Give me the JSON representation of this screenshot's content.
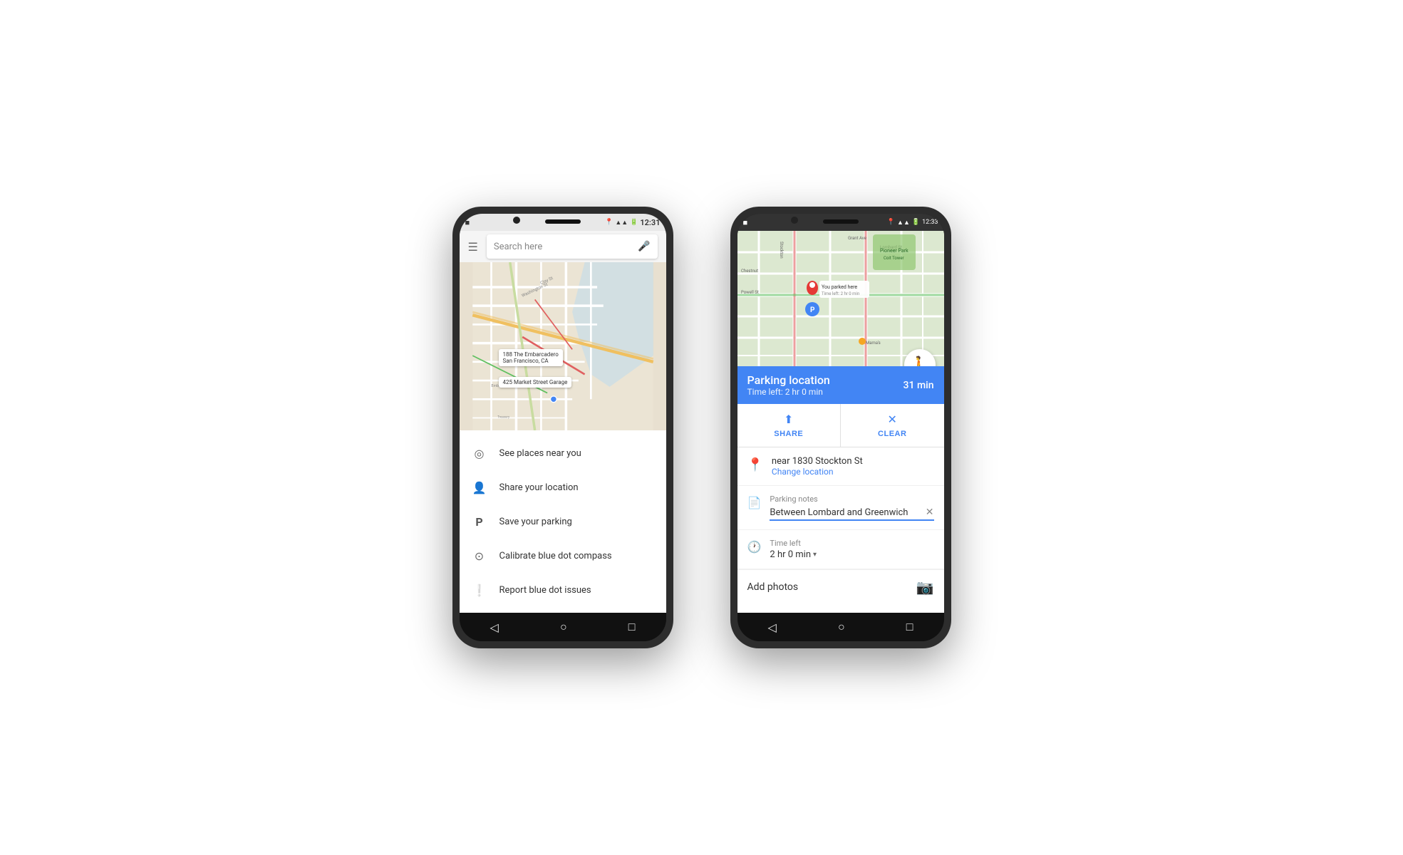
{
  "phone1": {
    "status_bar": {
      "left_icon": "☰",
      "time": "12:31",
      "icons": "▲ ⬆ ■ 🔋"
    },
    "search": {
      "placeholder": "Search here",
      "mic_icon": "🎤",
      "menu_icon": "☰"
    },
    "menu_items": [
      {
        "icon": "◎",
        "label": "See places near you"
      },
      {
        "icon": "👤",
        "label": "Share your location"
      },
      {
        "icon": "P",
        "label": "Save your parking"
      },
      {
        "icon": "⊙",
        "label": "Calibrate blue dot compass"
      },
      {
        "icon": "!",
        "label": "Report blue dot issues"
      }
    ],
    "nav": {
      "back": "◁",
      "home": "○",
      "square": "□"
    }
  },
  "phone2": {
    "status_bar": {
      "time": "12:33",
      "icons": "▲ ⬆ ■ 🔋"
    },
    "map": {
      "pin_label": "You parked here",
      "time_left_map": "Time left: 2 hr 0 min"
    },
    "parking_header": {
      "title": "Parking location",
      "time_left": "Time left: 2 hr 0 min",
      "duration": "31 min"
    },
    "actions": {
      "share_label": "SHARE",
      "clear_label": "CLEAR"
    },
    "location": {
      "address": "near 1830 Stockton St",
      "change_link": "Change location"
    },
    "notes": {
      "label": "Parking notes",
      "value": "Between Lombard and Greenwich"
    },
    "time_left": {
      "label": "Time left",
      "value": "2 hr 0 min"
    },
    "photos": {
      "label": "Add photos"
    },
    "nav": {
      "back": "◁",
      "home": "○",
      "square": "□"
    },
    "walk_icon": "🚶"
  }
}
